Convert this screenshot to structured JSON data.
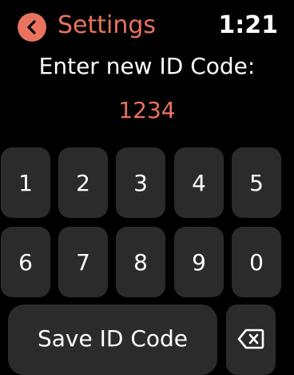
{
  "header": {
    "back_icon": "chevron-left-icon",
    "title": "Settings",
    "time": "1:21"
  },
  "prompt": "Enter new ID Code:",
  "code_value": "1234",
  "keypad": {
    "row1": [
      "1",
      "2",
      "3",
      "4",
      "5"
    ],
    "row2": [
      "6",
      "7",
      "8",
      "9",
      "0"
    ]
  },
  "actions": {
    "save_label": "Save ID Code",
    "delete_icon": "backspace-icon"
  },
  "colors": {
    "accent": "#e9735f",
    "key_background": "#2b2b2c",
    "background": "#000000"
  }
}
